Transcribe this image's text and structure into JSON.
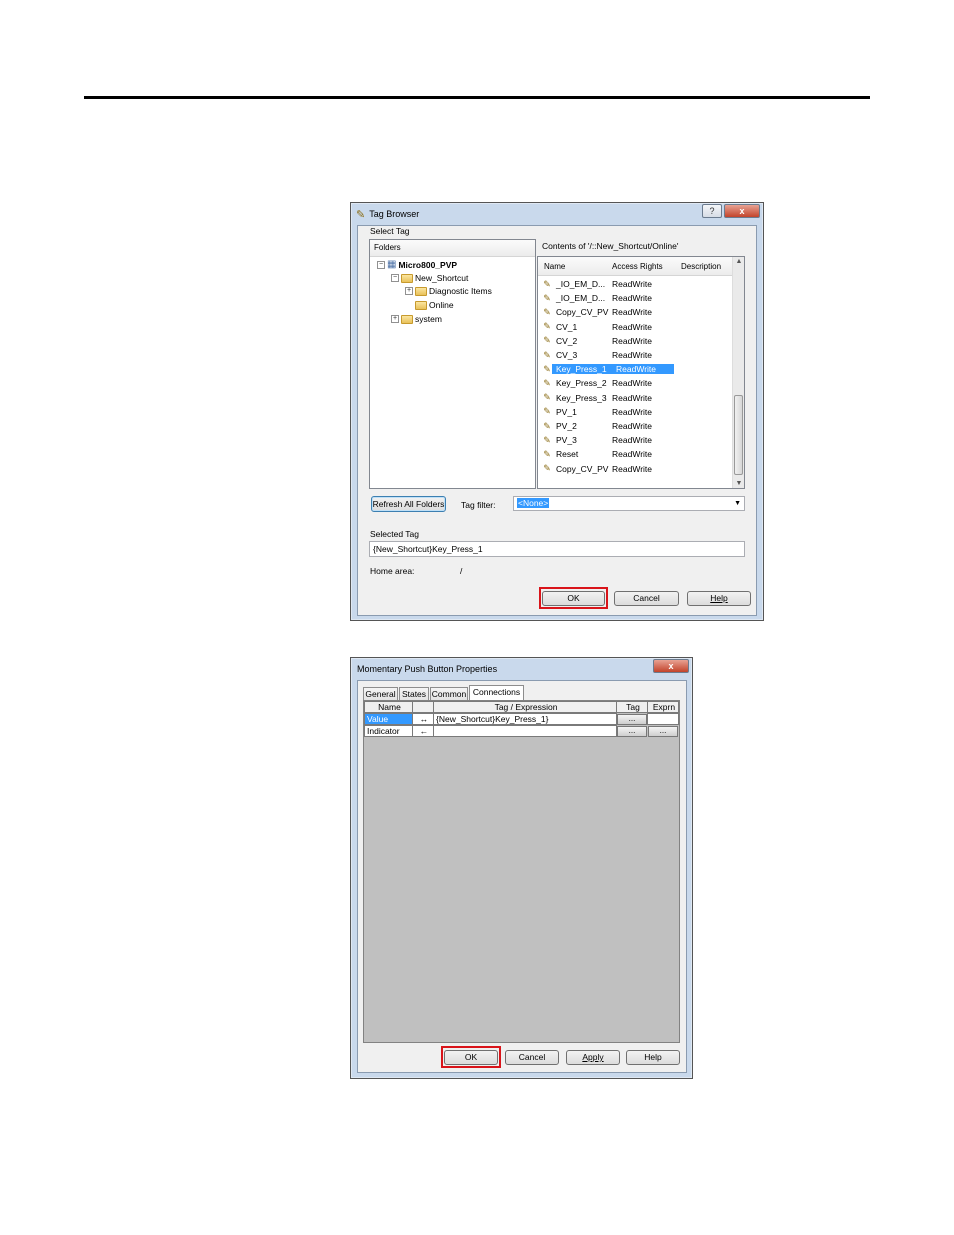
{
  "tag_browser": {
    "title": "Tag Browser",
    "help_btn": "?",
    "close_btn": "x",
    "select_tag_label": "Select Tag",
    "folders_header": "Folders",
    "contents_header": "Contents of '/::New_Shortcut/Online'",
    "tree": {
      "root": "Micro800_PVP",
      "child1": "New_Shortcut",
      "child1_1": "Diagnostic Items",
      "child1_2": "Online",
      "child2": "system"
    },
    "columns": {
      "name": "Name",
      "access": "Access Rights",
      "desc": "Description"
    },
    "rows": [
      {
        "name": "_IO_EM_D...",
        "access": "ReadWrite"
      },
      {
        "name": "_IO_EM_D...",
        "access": "ReadWrite"
      },
      {
        "name": "Copy_CV_PV",
        "access": "ReadWrite"
      },
      {
        "name": "CV_1",
        "access": "ReadWrite"
      },
      {
        "name": "CV_2",
        "access": "ReadWrite"
      },
      {
        "name": "CV_3",
        "access": "ReadWrite"
      },
      {
        "name": "Key_Press_1",
        "access": "ReadWrite"
      },
      {
        "name": "Key_Press_2",
        "access": "ReadWrite"
      },
      {
        "name": "Key_Press_3",
        "access": "ReadWrite"
      },
      {
        "name": "PV_1",
        "access": "ReadWrite"
      },
      {
        "name": "PV_2",
        "access": "ReadWrite"
      },
      {
        "name": "PV_3",
        "access": "ReadWrite"
      },
      {
        "name": "Reset",
        "access": "ReadWrite"
      },
      {
        "name": "Copy_CV_PV",
        "access": "ReadWrite"
      }
    ],
    "refresh_btn": "Refresh All Folders",
    "tag_filter_label": "Tag filter:",
    "tag_filter_value": "<None>",
    "selected_tag_label": "Selected Tag",
    "selected_tag_value": "{New_Shortcut}Key_Press_1",
    "home_area_label": "Home area:",
    "home_area_value": "/",
    "ok_btn": "OK",
    "cancel_btn": "Cancel",
    "help_dlg_btn": "Help"
  },
  "mpb": {
    "title": "Momentary Push Button Properties",
    "close_btn": "x",
    "tabs": [
      "General",
      "States",
      "Common",
      "Connections"
    ],
    "grid_headers": {
      "name": "Name",
      "tag_expr": "Tag / Expression",
      "tag": "Tag",
      "exprn": "Exprn"
    },
    "grid_rows": [
      {
        "name": "Value",
        "arrow": "↔",
        "expr": "{New_Shortcut}Key_Press_1}",
        "tag_btn": "...",
        "exprn_btn": ""
      },
      {
        "name": "Indicator",
        "arrow": "←",
        "expr": "",
        "tag_btn": "...",
        "exprn_btn": "..."
      }
    ],
    "ok_btn": "OK",
    "cancel_btn": "Cancel",
    "apply_btn": "Apply",
    "help_btn": "Help"
  },
  "icons": {
    "tag_browser": "tag-pencil-icon",
    "pc": "computer-icon",
    "folder": "folder-icon"
  },
  "colors": {
    "selection": "#3399ff",
    "highlight_box": "#d9141a",
    "grid_bg": "#c0c0c0"
  }
}
